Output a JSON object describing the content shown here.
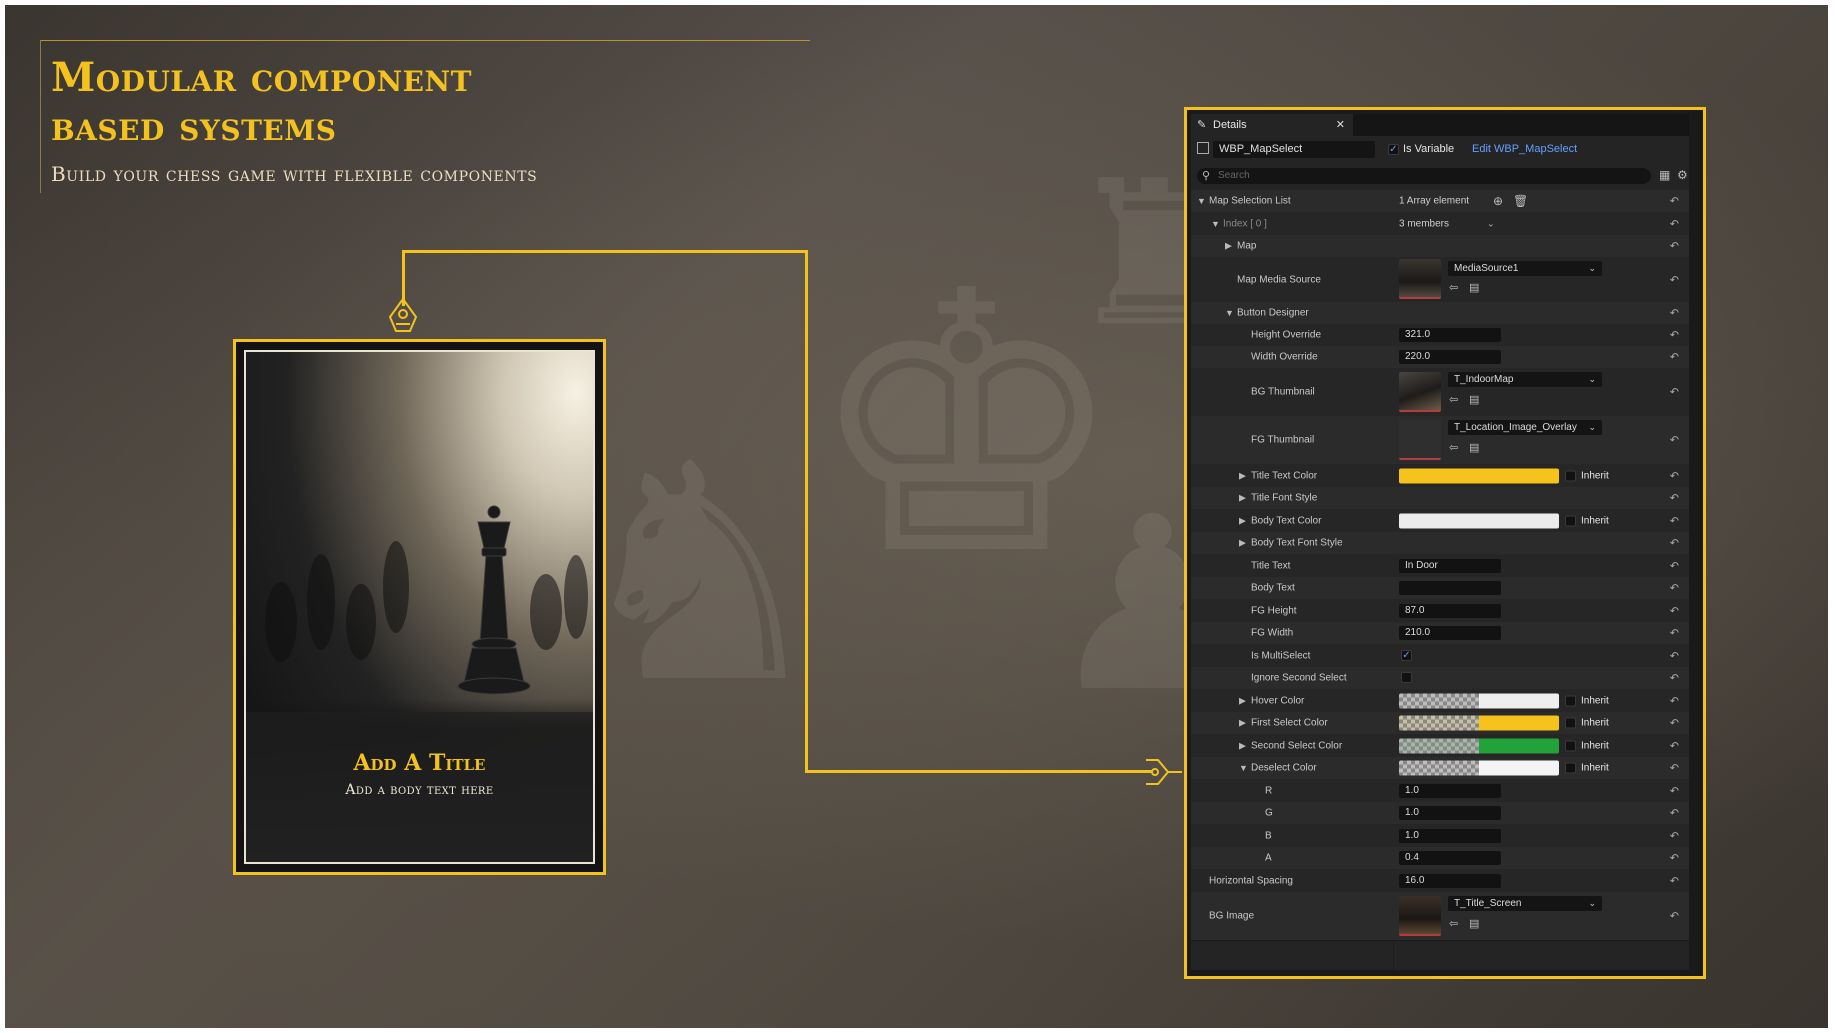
{
  "header": {
    "title_line1": "Modular component",
    "title_line2": "based systems",
    "subtitle": "Build your chess game with flexible components"
  },
  "card": {
    "title": "Add A Title",
    "body": "Add a body text here"
  },
  "panel": {
    "tab_label": "Details",
    "widget_name": "WBP_MapSelect",
    "is_variable_label": "Is Variable",
    "is_variable_checked": true,
    "edit_link": "Edit WBP_MapSelect",
    "search_placeholder": "Search",
    "inherit_label": "Inherit",
    "rows": {
      "map_selection_list": {
        "label": "Map Selection List",
        "value": "1 Array element"
      },
      "index0": {
        "label": "Index [ 0 ]",
        "value": "3 members"
      },
      "map": {
        "label": "Map"
      },
      "map_media_source": {
        "label": "Map Media Source",
        "asset": "MediaSource1"
      },
      "button_designer": {
        "label": "Button Designer"
      },
      "height_override": {
        "label": "Height Override",
        "value": "321.0"
      },
      "width_override": {
        "label": "Width Override",
        "value": "220.0"
      },
      "bg_thumbnail": {
        "label": "BG Thumbnail",
        "asset": "T_IndoorMap"
      },
      "fg_thumbnail": {
        "label": "FG Thumbnail",
        "asset": "T_Location_Image_Overlay"
      },
      "title_text_color": {
        "label": "Title Text Color",
        "color": "#f6c21c"
      },
      "title_font_style": {
        "label": "Title Font Style"
      },
      "body_text_color": {
        "label": "Body Text Color",
        "color": "#ececec"
      },
      "body_text_font_style": {
        "label": "Body Text Font Style"
      },
      "title_text": {
        "label": "Title Text",
        "value": "In Door"
      },
      "body_text": {
        "label": "Body Text",
        "value": ""
      },
      "fg_height": {
        "label": "FG Height",
        "value": "87.0"
      },
      "fg_width": {
        "label": "FG Width",
        "value": "210.0"
      },
      "is_multiselect": {
        "label": "Is MultiSelect",
        "checked": true
      },
      "ignore_second_select": {
        "label": "Ignore Second Select",
        "checked": false
      },
      "hover_color": {
        "label": "Hover Color",
        "color": "#efefef"
      },
      "first_select_color": {
        "label": "First Select Color",
        "color": "#f6c21c"
      },
      "second_select_color": {
        "label": "Second Select Color",
        "color": "#22a33a"
      },
      "deselect_color": {
        "label": "Deselect Color",
        "color": "#f4f4f4"
      },
      "r": {
        "label": "R",
        "value": "1.0"
      },
      "g": {
        "label": "G",
        "value": "1.0"
      },
      "b": {
        "label": "B",
        "value": "1.0"
      },
      "a": {
        "label": "A",
        "value": "0.4"
      },
      "horizontal_spacing": {
        "label": "Horizontal Spacing",
        "value": "16.0"
      },
      "bg_image": {
        "label": "BG Image",
        "asset": "T_Title_Screen"
      }
    }
  },
  "colors": {
    "accent": "#f3c21e",
    "link": "#63a0ff"
  }
}
